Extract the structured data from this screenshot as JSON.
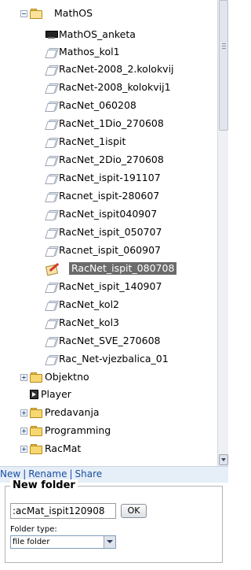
{
  "tree": {
    "root": {
      "label": "MathOS",
      "icon": "open-folder-icon"
    },
    "items": [
      {
        "label": "MathOS_anketa",
        "icon": "screen-icon"
      },
      {
        "label": "Mathos_kol1",
        "icon": "document-icon"
      },
      {
        "label": "RacNet-2008_2.kolokvij",
        "icon": "document-icon"
      },
      {
        "label": "RacNet-2008_kolokvij1",
        "icon": "document-icon"
      },
      {
        "label": "RacNet_060208",
        "icon": "document-icon"
      },
      {
        "label": "RacNet_1Dio_270608",
        "icon": "document-icon"
      },
      {
        "label": "RacNet_1ispit",
        "icon": "document-icon"
      },
      {
        "label": "RacNet_2Dio_270608",
        "icon": "document-icon"
      },
      {
        "label": "RacNet_ispit-191107",
        "icon": "document-icon"
      },
      {
        "label": "Racnet_ispit-280607",
        "icon": "document-icon"
      },
      {
        "label": "RacNet_ispit040907",
        "icon": "document-icon"
      },
      {
        "label": "RacNet_ispit_050707",
        "icon": "document-icon"
      },
      {
        "label": "Racnet_ispit_060907",
        "icon": "document-icon"
      },
      {
        "label": "RacNet_ispit_080708",
        "icon": "edit-document-icon",
        "selected": true
      },
      {
        "label": "RacNet_ispit_140907",
        "icon": "document-icon"
      },
      {
        "label": "RacNet_kol2",
        "icon": "document-icon"
      },
      {
        "label": "RacNet_kol3",
        "icon": "document-icon"
      },
      {
        "label": "RacNet_SVE_270608",
        "icon": "document-icon"
      },
      {
        "label": "Rac_Net-vjezbalica_01",
        "icon": "document-icon"
      }
    ],
    "siblings": [
      {
        "label": "Objektno",
        "icon": "folder-icon",
        "expandable": true
      },
      {
        "label": "Player",
        "icon": "player-icon",
        "expandable": false
      },
      {
        "label": "Predavanja",
        "icon": "folder-icon",
        "expandable": true
      },
      {
        "label": "Programming",
        "icon": "folder-icon",
        "expandable": true
      },
      {
        "label": "RacMat",
        "icon": "folder-icon",
        "expandable": true
      }
    ]
  },
  "actions": {
    "new": "New",
    "rename": "Rename",
    "share": "Share",
    "separator": "|"
  },
  "new_folder": {
    "legend": "New folder",
    "name_value": ":acMat_ispit120908",
    "ok_label": "OK",
    "type_label": "Folder type:",
    "type_value": "file folder"
  },
  "colors": {
    "selection": "#6b6b6b",
    "link": "#1b4fa0",
    "action_bar": "#e6eef7"
  }
}
